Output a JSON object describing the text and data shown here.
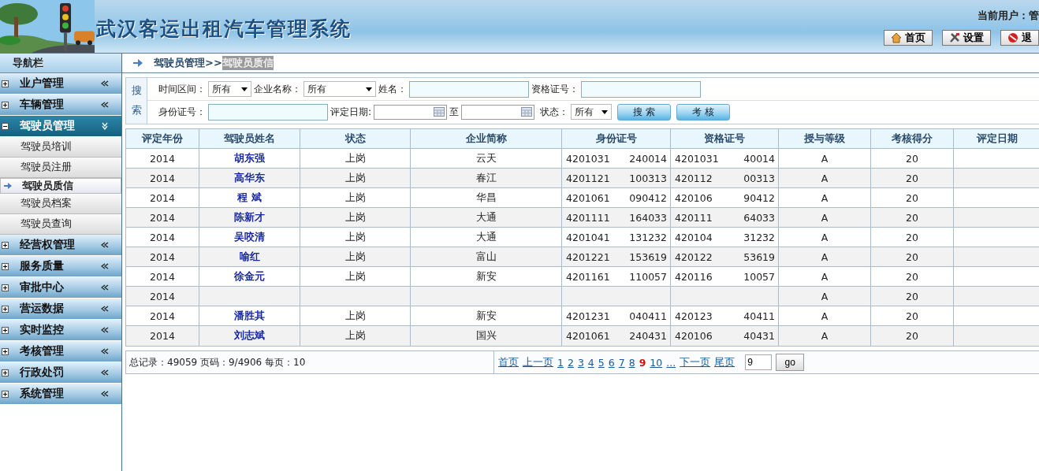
{
  "header": {
    "title": "武汉客运出租汽车管理系统",
    "current_user": "当前用户：管",
    "buttons": [
      {
        "kind": "home",
        "label": "首页"
      },
      {
        "kind": "settings",
        "label": "设置"
      },
      {
        "kind": "exit",
        "label": "退"
      }
    ]
  },
  "sidebar": {
    "title": "导航栏",
    "items": [
      {
        "label": "业户管理",
        "expanded": false
      },
      {
        "label": "车辆管理",
        "expanded": false
      },
      {
        "label": "驾驶员管理",
        "expanded": true,
        "children": [
          {
            "label": "驾驶员培训",
            "selected": false
          },
          {
            "label": "驾驶员注册",
            "selected": false
          },
          {
            "label": "驾驶员质信",
            "selected": true
          },
          {
            "label": "驾驶员档案",
            "selected": false
          },
          {
            "label": "驾驶员查询",
            "selected": false
          }
        ]
      },
      {
        "label": "经营权管理",
        "expanded": false
      },
      {
        "label": "服务质量",
        "expanded": false
      },
      {
        "label": "审批中心",
        "expanded": false
      },
      {
        "label": "营运数据",
        "expanded": false
      },
      {
        "label": "实时监控",
        "expanded": false
      },
      {
        "label": "考核管理",
        "expanded": false
      },
      {
        "label": "行政处罚",
        "expanded": false
      },
      {
        "label": "系统管理",
        "expanded": false
      }
    ]
  },
  "breadcrumb": {
    "parent": "驾驶员管理>>",
    "current": "驾驶员质信"
  },
  "search": {
    "label": "搜索",
    "time_range": {
      "label": "时间区间：",
      "value": "所有"
    },
    "company": {
      "label": "企业名称：",
      "value": "所有"
    },
    "name": {
      "label": "姓名："
    },
    "qualification_no": {
      "label": "资格证号："
    },
    "id_no": {
      "label": "身份证号："
    },
    "rating_date": {
      "label": "评定日期:",
      "to": "至"
    },
    "status": {
      "label": "状态：",
      "value": "所有"
    },
    "buttons": [
      "搜 索",
      "考 核"
    ]
  },
  "table": {
    "columns": [
      "评定年份",
      "驾驶员姓名",
      "状态",
      "企业简称",
      "身份证号",
      "资格证号",
      "授与等级",
      "考核得分",
      "评定日期"
    ],
    "rows": [
      {
        "year": "2014",
        "name": "胡东强",
        "status": "上岗",
        "company": "云天",
        "id_no": [
          "4201031",
          "240014"
        ],
        "qualification_no": [
          "4201031",
          "40014"
        ],
        "grade": "A",
        "score": "20"
      },
      {
        "year": "2014",
        "name": "高华东",
        "status": "上岗",
        "company": "春江",
        "id_no": [
          "4201121",
          "100313"
        ],
        "qualification_no": [
          "420112",
          "00313"
        ],
        "grade": "A",
        "score": "20"
      },
      {
        "year": "2014",
        "name": "程 斌",
        "status": "上岗",
        "company": "华昌",
        "id_no": [
          "4201061",
          "090412"
        ],
        "qualification_no": [
          "420106",
          "90412"
        ],
        "grade": "A",
        "score": "20"
      },
      {
        "year": "2014",
        "name": "陈新才",
        "status": "上岗",
        "company": "大通",
        "id_no": [
          "4201111",
          "164033"
        ],
        "qualification_no": [
          "420111",
          "64033"
        ],
        "grade": "A",
        "score": "20"
      },
      {
        "year": "2014",
        "name": "吴咬清",
        "status": "上岗",
        "company": "大通",
        "id_no": [
          "4201041",
          "131232"
        ],
        "qualification_no": [
          "420104",
          "31232"
        ],
        "grade": "A",
        "score": "20"
      },
      {
        "year": "2014",
        "name": "喻红",
        "status": "上岗",
        "company": "富山",
        "id_no": [
          "4201221",
          "153619"
        ],
        "qualification_no": [
          "420122",
          "53619"
        ],
        "grade": "A",
        "score": "20"
      },
      {
        "year": "2014",
        "name": "徐金元",
        "status": "上岗",
        "company": "新安",
        "id_no": [
          "4201161",
          "110057"
        ],
        "qualification_no": [
          "420116",
          "10057"
        ],
        "grade": "A",
        "score": "20"
      },
      {
        "year": "2014",
        "grade": "A",
        "score": "20"
      },
      {
        "year": "2014",
        "name": "潘胜其",
        "status": "上岗",
        "company": "新安",
        "id_no": [
          "4201231",
          "040411"
        ],
        "qualification_no": [
          "420123",
          "40411"
        ],
        "grade": "A",
        "score": "20"
      },
      {
        "year": "2014",
        "name": "刘志斌",
        "status": "上岗",
        "company": "国兴",
        "id_no": [
          "4201061",
          "240431"
        ],
        "qualification_no": [
          "420106",
          "40431"
        ],
        "grade": "A",
        "score": "20"
      }
    ]
  },
  "pager": {
    "summary": "总记录：49059 页码：9/4906 每页：10",
    "links": [
      {
        "label": "首页",
        "selected": false
      },
      {
        "label": "上一页",
        "selected": false
      },
      {
        "label": "1",
        "selected": false
      },
      {
        "label": "2",
        "selected": false
      },
      {
        "label": "3",
        "selected": false
      },
      {
        "label": "4",
        "selected": false
      },
      {
        "label": "5",
        "selected": false
      },
      {
        "label": "6",
        "selected": false
      },
      {
        "label": "7",
        "selected": false
      },
      {
        "label": "8",
        "selected": false
      },
      {
        "label": "9",
        "selected": true
      },
      {
        "label": "10",
        "selected": false
      },
      {
        "label": "...",
        "selected": false
      },
      {
        "label": "下一页",
        "selected": false
      },
      {
        "label": "尾页",
        "selected": false
      }
    ],
    "page_input": "9",
    "go": "go"
  }
}
